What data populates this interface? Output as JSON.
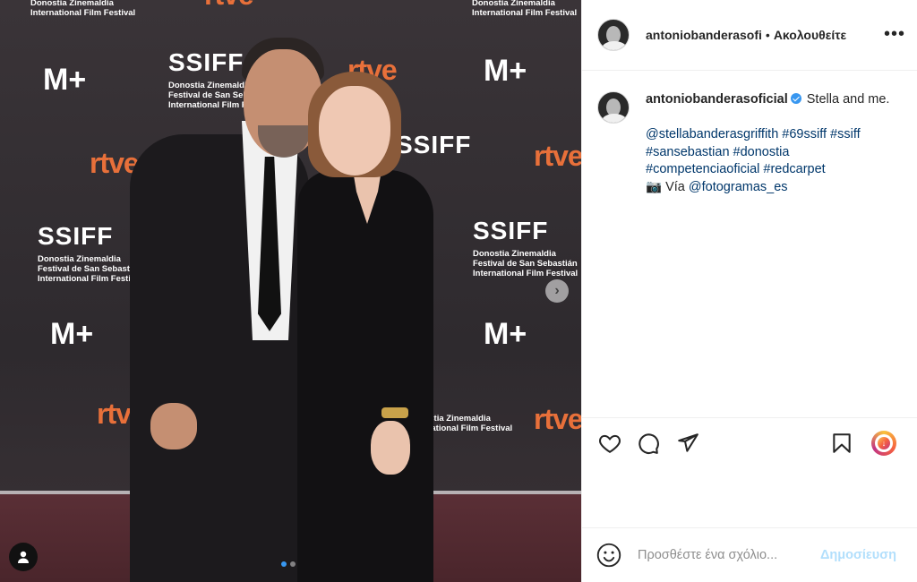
{
  "media": {
    "backdrop_logos": {
      "ssiff": "SSIFF",
      "rtve": "rtve",
      "movistar": "M+",
      "festival_line1": "Donostia Zinemaldia",
      "festival_line2": "Festival de San Sebastián",
      "festival_line3": "International Film Festival"
    },
    "carousel": {
      "current": 1,
      "total": 2
    },
    "icons": {
      "next": "chevron-right-icon",
      "tag": "user-icon"
    }
  },
  "header": {
    "username": "antoniobanderasofi",
    "separator": "•",
    "follow_status": "Ακολουθείτε",
    "more": "•••"
  },
  "caption": {
    "username": "antoniobanderasoficial",
    "text_start": " Stella and me.",
    "mention_1": "@stellabanderasgriffith",
    "hashtags_line1": [
      "#69ssiff",
      "#ssiff"
    ],
    "hashtags_line2": [
      "#sansebastian",
      "#donostia"
    ],
    "hashtags_line3": [
      "#competenciaoficial",
      "#redcarpet"
    ],
    "camera_emoji": "📷",
    "via_text": " Vía ",
    "mention_2": "@fotogramas_es"
  },
  "actions": {
    "icons": [
      "heart-icon",
      "comment-icon",
      "share-icon",
      "bookmark-icon"
    ]
  },
  "comment": {
    "placeholder": "Προσθέστε ένα σχόλιο...",
    "post_label": "Δημοσίευση"
  },
  "colors": {
    "link": "#00376b",
    "verified": "#3897f0",
    "post_button_disabled": "#b2dffc",
    "rtve_orange": "#e8703a"
  }
}
